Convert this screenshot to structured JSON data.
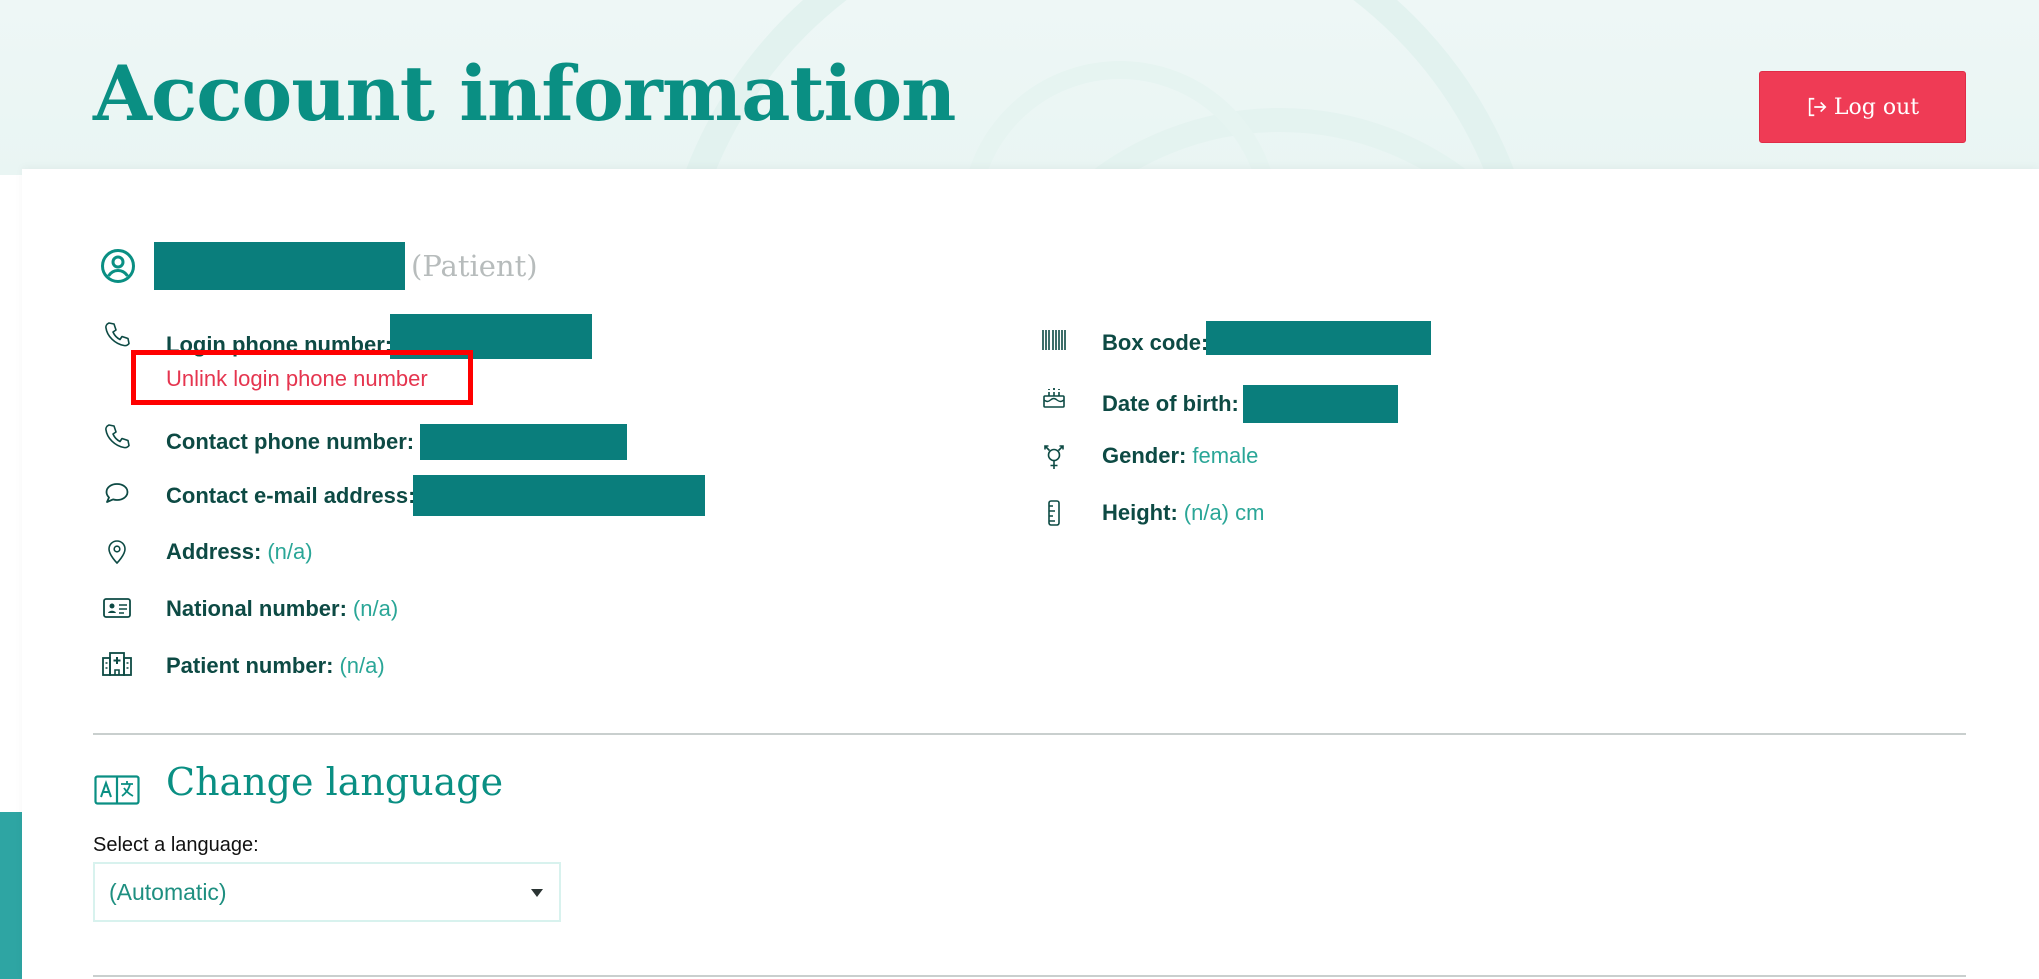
{
  "header": {
    "title": "Account information",
    "logout_label": "Log out"
  },
  "profile": {
    "role": "(Patient)"
  },
  "left_fields": [
    {
      "icon": "phone-icon",
      "label": "Login phone number:",
      "value": ""
    },
    {
      "icon": "phone-icon",
      "label": "Contact phone number:",
      "value": ""
    },
    {
      "icon": "chat-bubble-icon",
      "label": "Contact e-mail address:",
      "value": ""
    },
    {
      "icon": "location-pin-icon",
      "label": "Address:",
      "value": "(n/a)"
    },
    {
      "icon": "id-card-icon",
      "label": "National number:",
      "value": "(n/a)"
    },
    {
      "icon": "hospital-icon",
      "label": "Patient number:",
      "value": "(n/a)"
    }
  ],
  "right_fields": [
    {
      "icon": "barcode-icon",
      "label": "Box code:",
      "value": ""
    },
    {
      "icon": "birthday-cake-icon",
      "label": "Date of birth:",
      "value": ""
    },
    {
      "icon": "gender-icon",
      "label": "Gender:",
      "value": "female"
    },
    {
      "icon": "ruler-icon",
      "label": "Height:",
      "value": "(n/a) cm"
    }
  ],
  "unlink_label": "Unlink login phone number",
  "language": {
    "title": "Change language",
    "select_label": "Select a language:",
    "selected": "(Automatic)"
  },
  "colors": {
    "primary": "#0a8f83",
    "danger": "#ef3b55",
    "redaction": "#0a7e7c",
    "value_text": "#2aa697"
  }
}
